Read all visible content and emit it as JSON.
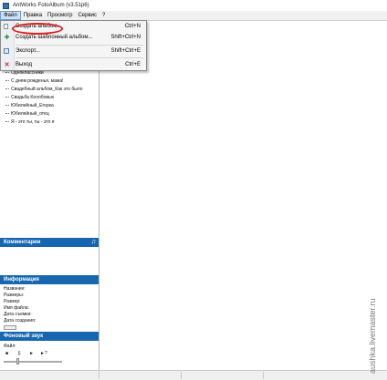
{
  "window": {
    "title": "AntWorks FotoAlbum (v3.51p6)"
  },
  "menu": {
    "items": [
      "Файл",
      "Правка",
      "Просмотр",
      "Сервис",
      "?"
    ]
  },
  "file_menu": {
    "items": [
      {
        "label": "Создать альбом...",
        "shortcut": "Ctrl+N",
        "icon": "new-album-icon"
      },
      {
        "label": "Создать шаблонный альбом...",
        "shortcut": "Shift+Ctrl+N",
        "icon": "template-album-icon"
      },
      {
        "label": "Экспорт...",
        "shortcut": "Shift+Ctrl+E",
        "icon": "export-icon"
      },
      {
        "label": "Выход",
        "shortcut": "Ctrl+E",
        "icon": "exit-icon"
      }
    ]
  },
  "tree": {
    "items": [
      "Одноклассники",
      "С днем рожденья, мама!",
      "Свадебный альбом_Как это было",
      "Свадьба Колобовых",
      "Юбилейный_Егорка",
      "Юбилейный_отец",
      "Я - это ты, ты - это я"
    ]
  },
  "comments": {
    "title": "Комментарии"
  },
  "info": {
    "title": "Информация",
    "fields": [
      "Название:",
      "Размеры:",
      "Размер:",
      "Имя файла:",
      "Дата съемки:",
      "Дата создания:"
    ]
  },
  "sound": {
    "title": "Фоновый звук",
    "file_label": "Файл:",
    "controls": [
      "■",
      "||",
      "►",
      "►?"
    ]
  },
  "watermark": "aushka.livemaster.ru",
  "colors": {
    "panel_header": "#1667b0",
    "highlight": "#e01f1f"
  }
}
